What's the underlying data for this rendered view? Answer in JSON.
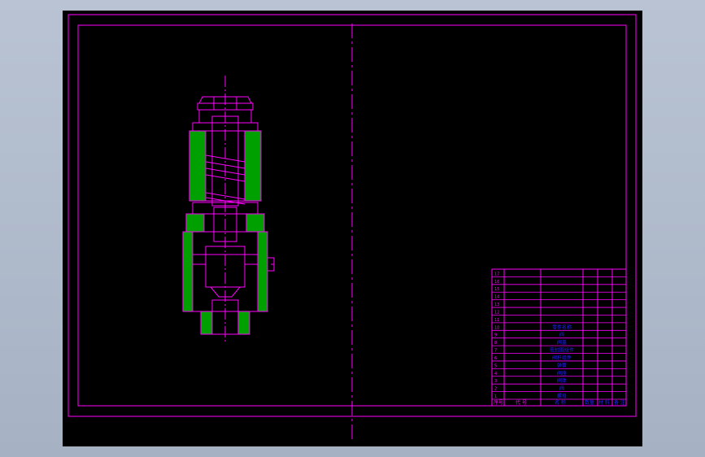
{
  "app": {
    "name": "CAD drawing viewer"
  },
  "colors": {
    "background": "#a9b5c7",
    "canvas": "#000000",
    "frame": "#ff00ff",
    "section_hatch": "#00aa00",
    "bom_text": "#2222ff"
  },
  "bom": {
    "row_numbers": [
      "17",
      "16",
      "15",
      "14",
      "13",
      "12",
      "11",
      "10",
      "9",
      "8",
      "7",
      "6",
      "5",
      "4",
      "3",
      "2",
      "1"
    ],
    "part_names": [
      "零件名称",
      "阀",
      "阀盖",
      "密封圈组件",
      "阀杆组件",
      "弹簧",
      "阀座",
      "阀体",
      "阀",
      "螺母"
    ],
    "header": {
      "no": "序号",
      "code": "代 号",
      "name": "名 称",
      "qty": "数量",
      "material": "材 料",
      "note": "备 注"
    }
  }
}
